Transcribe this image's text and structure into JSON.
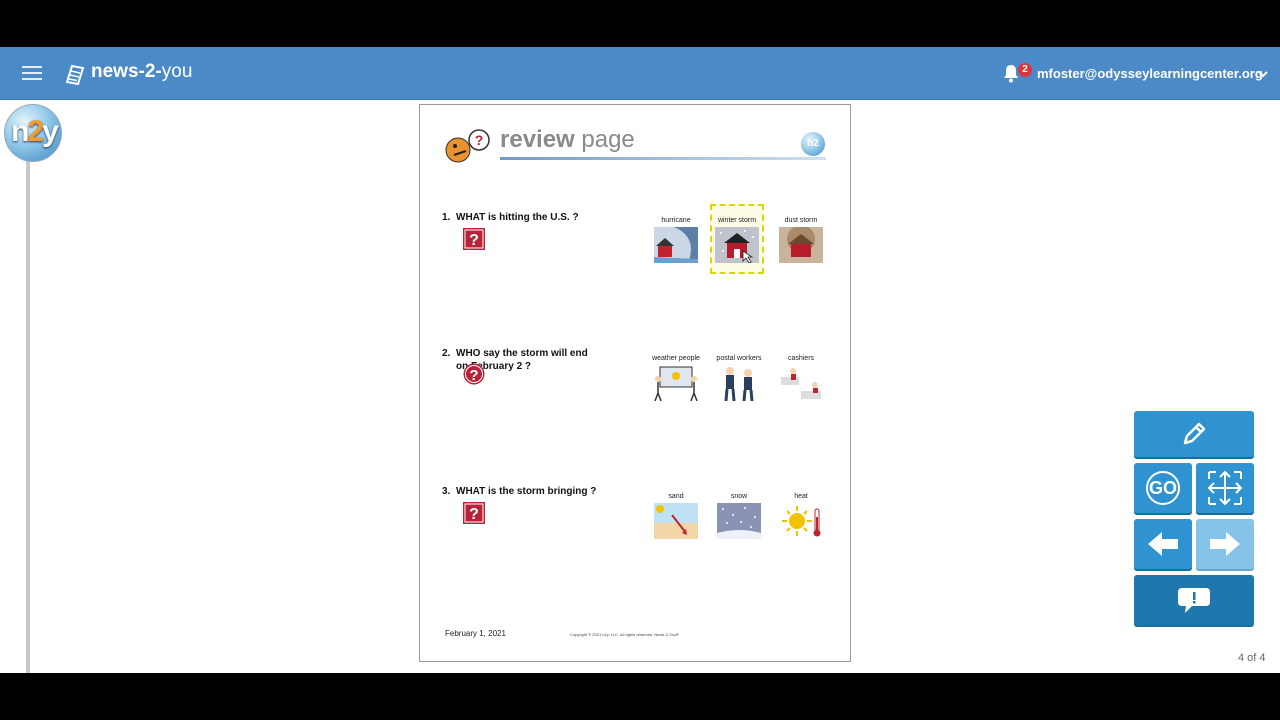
{
  "app": {
    "brand_bold": "news-2-",
    "brand_light": "you"
  },
  "user": {
    "email": "mfoster@odysseylearningcenter.org",
    "notifications": "2"
  },
  "sidebar": {
    "logo_prefix": "n",
    "logo_two": "2",
    "logo_suffix": "y"
  },
  "document": {
    "title_bold": "review",
    "title_light": "page",
    "questions": [
      {
        "number": "1.",
        "text": "WHAT  is hitting the U.S. ?",
        "choices": [
          {
            "label": "hurricane"
          },
          {
            "label": "winter storm",
            "selected": true
          },
          {
            "label": "dust storm"
          }
        ]
      },
      {
        "number": "2.",
        "text": "WHO  say the storm will end on February 2 ?",
        "choices": [
          {
            "label": "weather people"
          },
          {
            "label": "postal workers"
          },
          {
            "label": "cashiers"
          }
        ]
      },
      {
        "number": "3.",
        "text": "WHAT  is the storm bringing ?",
        "choices": [
          {
            "label": "sand"
          },
          {
            "label": "snow"
          },
          {
            "label": "heat"
          }
        ]
      }
    ],
    "footer_date": "February 1, 2021",
    "footer_copyright": "Copyright © 2021 n2y, LLC. All rights reserved. News-2-You®"
  },
  "controls": {
    "go_label": "GO"
  },
  "pager": "4 of 4",
  "colors": {
    "topbar": "#4b8ac6",
    "control": "#2f93d1",
    "selected_border": "#d8d800",
    "question_icon": "#b8233a"
  }
}
